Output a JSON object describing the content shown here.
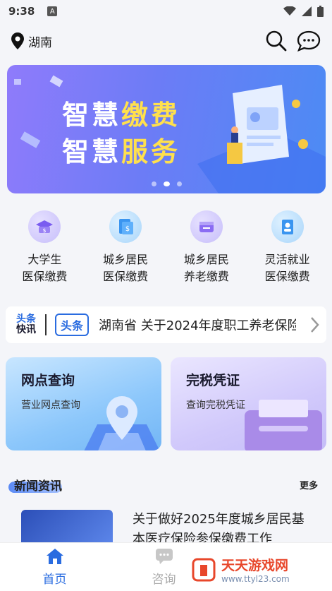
{
  "status_bar": {
    "time": "9:38",
    "sim_label": "A"
  },
  "header": {
    "location": "湖南",
    "location_icon": "location-pin-icon",
    "search_icon": "search-icon",
    "message_icon": "chat-bubble-icon"
  },
  "banner": {
    "line1_a": "智慧",
    "line1_b": "缴费",
    "line2_a": "智慧",
    "line2_b": "服务",
    "highlight_color": "#ffe04d"
  },
  "services": [
    {
      "line1": "大学生",
      "line2": "医保缴费"
    },
    {
      "line1": "城乡居民",
      "line2": "医保缴费"
    },
    {
      "line1": "城乡居民",
      "line2": "养老缴费"
    },
    {
      "line1": "灵活就业",
      "line2": "医保缴费"
    }
  ],
  "ticker": {
    "logo_top": "头条",
    "logo_bottom": "快讯",
    "tag": "头条",
    "text": "湖南省 关于2024年度职工养老保险"
  },
  "cards": [
    {
      "title": "网点查询",
      "subtitle": "营业网点查询"
    },
    {
      "title": "完税凭证",
      "subtitle": "查询完税凭证"
    }
  ],
  "news": {
    "section_title": "新闻资讯",
    "more_label": "更多",
    "items": [
      {
        "title": "关于做好2025年度城乡居民基本医疗保险参保缴费工作"
      }
    ]
  },
  "tabbar": {
    "tabs": [
      {
        "label": "首页"
      },
      {
        "label": "咨询"
      }
    ]
  },
  "watermark": {
    "brand": "天天游戏网",
    "url": "www.ttyl23.com"
  },
  "colors": {
    "accent": "#2a6ce0"
  }
}
